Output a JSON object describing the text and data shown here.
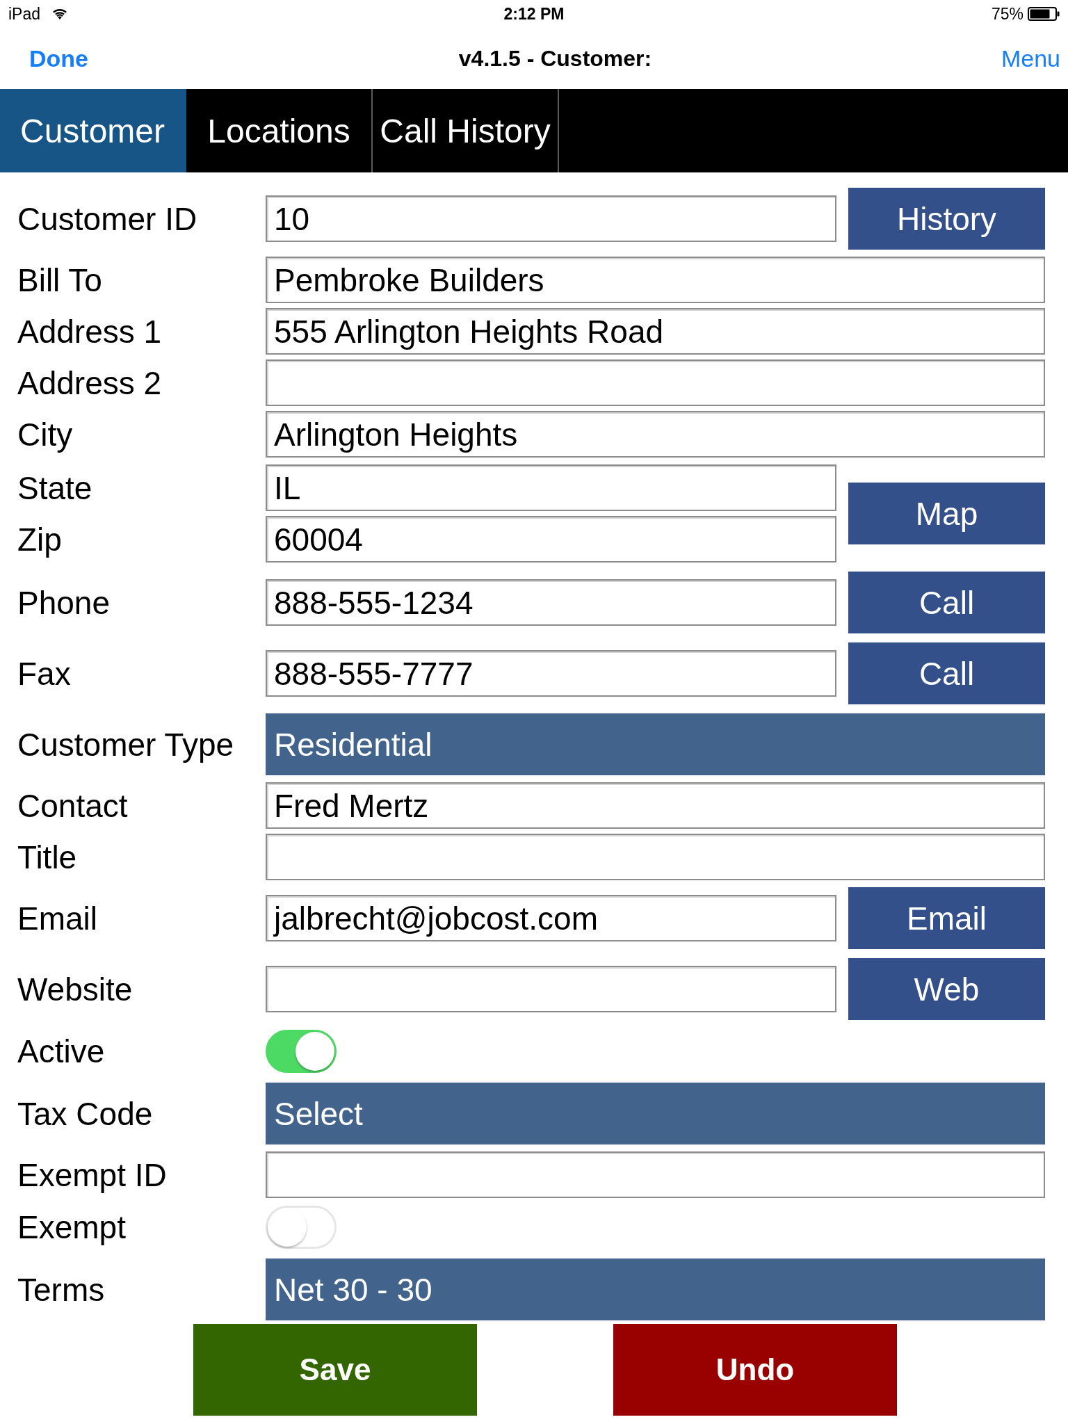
{
  "status_bar": {
    "device": "iPad",
    "time": "2:12 PM",
    "battery": "75%"
  },
  "nav_bar": {
    "left_button": "Done",
    "title": "v4.1.5 - Customer:",
    "right_button": "Menu"
  },
  "tabs": [
    {
      "label": "Customer",
      "selected": true
    },
    {
      "label": "Locations",
      "selected": false
    },
    {
      "label": "Call History",
      "selected": false
    }
  ],
  "form": {
    "rows": [
      {
        "kind": "text",
        "label": "Customer ID",
        "value": "10",
        "button": "History"
      },
      {
        "kind": "text",
        "label": "Bill To",
        "value": "Pembroke Builders"
      },
      {
        "kind": "text",
        "label": "Address 1",
        "value": "555 Arlington Heights Road"
      },
      {
        "kind": "text",
        "label": "Address 2"
      },
      {
        "kind": "text",
        "label": "City",
        "value": "Arlington Heights"
      },
      {
        "kind": "group",
        "fields": [
          {
            "label": "State",
            "value": "IL"
          },
          {
            "label": "Zip",
            "value": "60004"
          }
        ],
        "button": "Map"
      },
      {
        "kind": "text",
        "label": "Phone",
        "value": "888-555-1234",
        "button": "Call"
      },
      {
        "kind": "text",
        "label": "Fax",
        "value": "888-555-7777",
        "button": "Call"
      },
      {
        "kind": "select",
        "label": "Customer Type",
        "value": "Residential"
      },
      {
        "kind": "text",
        "label": "Contact",
        "value": "Fred Mertz"
      },
      {
        "kind": "text",
        "label": "Title"
      },
      {
        "kind": "text",
        "label": "Email",
        "value": "jalbrecht@jobcost.com",
        "button": "Email"
      },
      {
        "kind": "text",
        "label": "Website",
        "button": "Web"
      },
      {
        "kind": "toggle",
        "label": "Active",
        "on": true
      },
      {
        "kind": "select",
        "label": "Tax Code",
        "value": "Select"
      },
      {
        "kind": "text",
        "label": "Exempt ID"
      },
      {
        "kind": "toggle",
        "label": "Exempt",
        "on": false
      },
      {
        "kind": "select",
        "label": "Terms",
        "value": "Net 30 - 30"
      }
    ]
  },
  "footer_buttons": [
    {
      "label": "Save",
      "color": "#336600"
    },
    {
      "label": "Undo",
      "color": "#990000"
    }
  ]
}
